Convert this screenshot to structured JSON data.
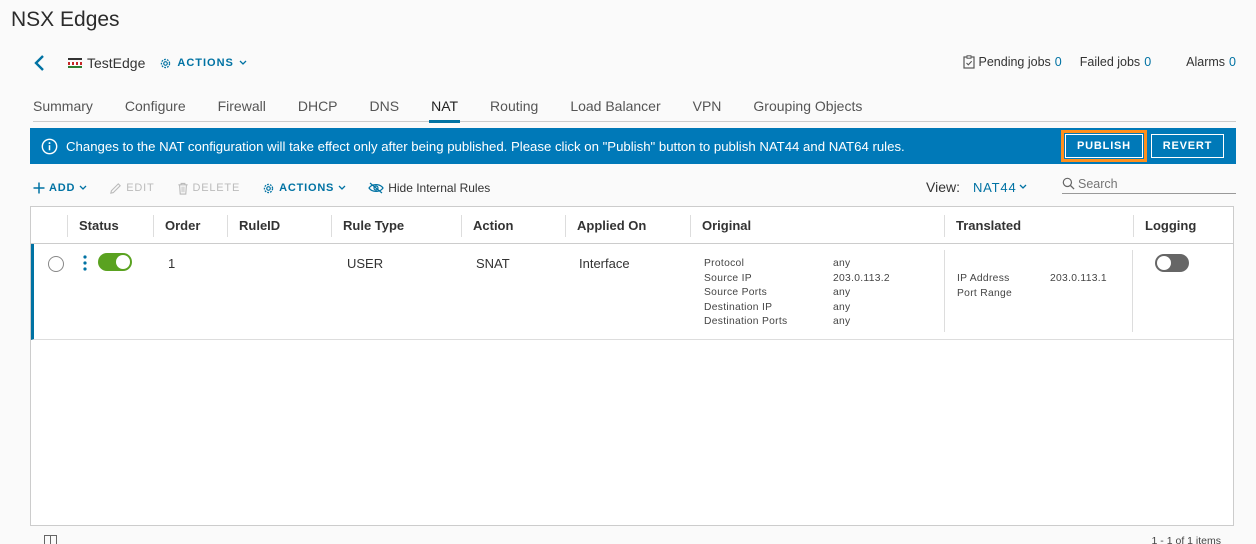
{
  "page": {
    "title": "NSX Edges"
  },
  "edge": {
    "name": "TestEdge",
    "actions_label": "ACTIONS"
  },
  "status": {
    "pending_label": "Pending jobs",
    "pending_count": "0",
    "failed_label": "Failed jobs",
    "failed_count": "0",
    "alarms_label": "Alarms",
    "alarms_count": "0"
  },
  "tabs": [
    {
      "label": "Summary"
    },
    {
      "label": "Configure"
    },
    {
      "label": "Firewall"
    },
    {
      "label": "DHCP"
    },
    {
      "label": "DNS"
    },
    {
      "label": "NAT",
      "active": true
    },
    {
      "label": "Routing"
    },
    {
      "label": "Load Balancer"
    },
    {
      "label": "VPN"
    },
    {
      "label": "Grouping Objects"
    }
  ],
  "banner": {
    "message": "Changes to the NAT configuration will take effect only after being published. Please click on \"Publish\" button to publish NAT44 and NAT64 rules.",
    "publish_label": "PUBLISH",
    "revert_label": "REVERT"
  },
  "toolbar": {
    "add_label": "ADD",
    "edit_label": "EDIT",
    "delete_label": "DELETE",
    "actions_label": "ACTIONS",
    "hide_internal_label": "Hide Internal Rules",
    "view_label": "View:",
    "view_value": "NAT44",
    "search_placeholder": "Search"
  },
  "columns": {
    "status": "Status",
    "order": "Order",
    "ruleid": "RuleID",
    "rule_type": "Rule Type",
    "action": "Action",
    "applied_on": "Applied On",
    "original": "Original",
    "translated": "Translated",
    "logging": "Logging"
  },
  "rows": [
    {
      "enabled": true,
      "order": "1",
      "ruleid": "",
      "rule_type": "USER",
      "action": "SNAT",
      "applied_on": "Interface",
      "original": {
        "protocol_label": "Protocol",
        "protocol": "any",
        "source_ip_label": "Source IP",
        "source_ip": "203.0.113.2",
        "source_ports_label": "Source Ports",
        "source_ports": "any",
        "dest_ip_label": "Destination IP",
        "dest_ip": "any",
        "dest_ports_label": "Destination Ports",
        "dest_ports": "any"
      },
      "translated": {
        "ip_label": "IP Address",
        "ip": "203.0.113.1",
        "port_range_label": "Port Range",
        "port_range": ""
      },
      "logging": false
    }
  ],
  "footer": {
    "count": "1 - 1 of 1 items"
  },
  "colors": {
    "accent": "#0072a3",
    "banner": "#0079b8",
    "toggle_on": "#5aa220",
    "highlight": "#ff8f1c"
  }
}
